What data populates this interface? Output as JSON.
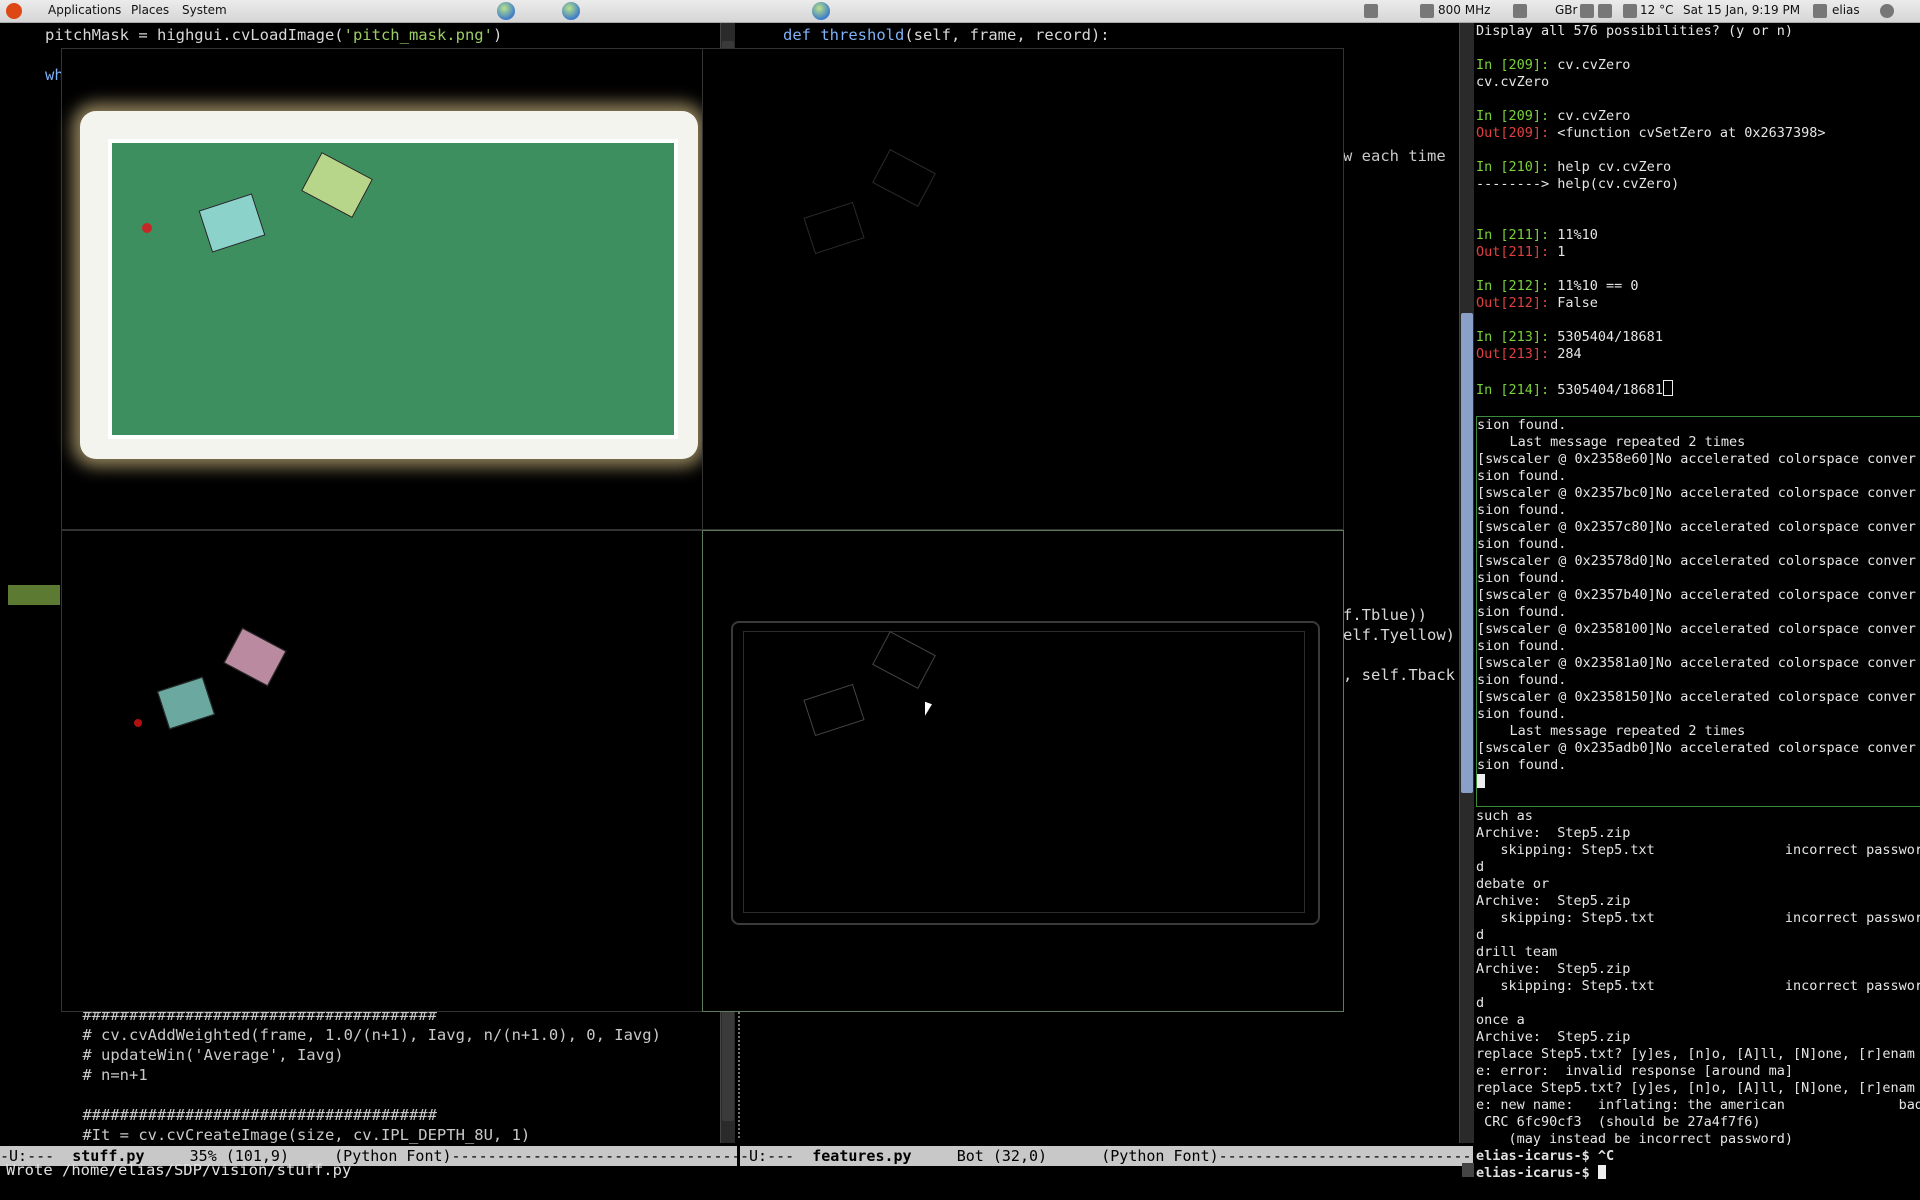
{
  "panel": {
    "menus": [
      "Applications",
      "Places",
      "System"
    ],
    "cpu": "800 MHz",
    "keyboard": "GBr",
    "temperature": "12 °C",
    "datetime": "Sat 15 Jan,  9:19 PM",
    "user": "elias"
  },
  "editor_left": {
    "line1": "pitchMask = highgui.cvLoadImage(",
    "line1_str": "'pitch_mask.png'",
    "line1_end": ")",
    "line2": "wh",
    "bottom_lines": [
      "    ######################################",
      "    # cv.cvAddWeighted(frame, 1.0/(n+1), Iavg, n/(n+1.0), 0, Iavg)",
      "    # updateWin('Average', Iavg)",
      "    # n=n+1",
      "",
      "    ######################################",
      "    #It = cv.cvCreateImage(size, cv.IPL_DEPTH_8U, 1)"
    ],
    "modeline": "-U:---  ",
    "filename": "stuff.py",
    "modeline_rest": "     35% (101,9)     (Python Font)--------------------------------------------------------"
  },
  "editor_right": {
    "line1_kw": "def",
    "line1_fn": "threshold",
    "line1_rest": "(self, frame, record):",
    "fragment_each_time": "w each time",
    "fragment_tblue": "f.Tblue))",
    "fragment_tyellow": "elf.Tyellow)",
    "fragment_tback": ", self.Tback",
    "modeline": "-U:---  ",
    "filename": "features.py",
    "modeline_rest": "     Bot (32,0)      (Python Font)------------------------------------------"
  },
  "minibuffer": "Wrote /home/elias/SDP/vision/stuff.py",
  "ipython": [
    {
      "t": "plain",
      "text": "Display all 576 possibilities? (y or n)"
    },
    {
      "t": "blank",
      "text": ""
    },
    {
      "t": "in",
      "num": "209",
      "text": "cv.cvZero"
    },
    {
      "t": "plain",
      "text": "cv.cvZero"
    },
    {
      "t": "blank",
      "text": ""
    },
    {
      "t": "in",
      "num": "209",
      "text": "cv.cvZero"
    },
    {
      "t": "out",
      "num": "209",
      "text": "<function cvSetZero at 0x2637398>"
    },
    {
      "t": "blank",
      "text": ""
    },
    {
      "t": "in",
      "num": "210",
      "text": "help cv.cvZero"
    },
    {
      "t": "plain",
      "text": "--------> help(cv.cvZero)"
    },
    {
      "t": "blank",
      "text": ""
    },
    {
      "t": "blank",
      "text": ""
    },
    {
      "t": "in",
      "num": "211",
      "text": "11%10"
    },
    {
      "t": "out",
      "num": "211",
      "text": "1"
    },
    {
      "t": "blank",
      "text": ""
    },
    {
      "t": "in",
      "num": "212",
      "text": "11%10 == 0"
    },
    {
      "t": "out",
      "num": "212",
      "text": "False"
    },
    {
      "t": "blank",
      "text": ""
    },
    {
      "t": "in",
      "num": "213",
      "text": "5305404/18681"
    },
    {
      "t": "out",
      "num": "213",
      "text": "284"
    },
    {
      "t": "blank",
      "text": ""
    },
    {
      "t": "in",
      "num": "214",
      "text": "5305404/18681"
    }
  ],
  "swscaler": [
    "sion found.",
    "    Last message repeated 2 times",
    "[swscaler @ 0x2358e60]No accelerated colorspace conver",
    "sion found.",
    "[swscaler @ 0x2357bc0]No accelerated colorspace conver",
    "sion found.",
    "[swscaler @ 0x2357c80]No accelerated colorspace conver",
    "sion found.",
    "[swscaler @ 0x23578d0]No accelerated colorspace conver",
    "sion found.",
    "[swscaler @ 0x2357b40]No accelerated colorspace conver",
    "sion found.",
    "[swscaler @ 0x2358100]No accelerated colorspace conver",
    "sion found.",
    "[swscaler @ 0x23581a0]No accelerated colorspace conver",
    "sion found.",
    "[swscaler @ 0x2358150]No accelerated colorspace conver",
    "sion found.",
    "    Last message repeated 2 times",
    "[swscaler @ 0x235adb0]No accelerated colorspace conver",
    "sion found."
  ],
  "shell": [
    "such as",
    "Archive:  Step5.zip",
    "   skipping: Step5.txt                incorrect passwor",
    "d",
    "debate or",
    "Archive:  Step5.zip",
    "   skipping: Step5.txt                incorrect passwor",
    "d",
    "drill team",
    "Archive:  Step5.zip",
    "   skipping: Step5.txt                incorrect passwor",
    "d",
    "once a",
    "Archive:  Step5.zip",
    "replace Step5.txt? [y]es, [n]o, [A]ll, [N]one, [r]enam",
    "e: error:  invalid response [around ma]",
    "replace Step5.txt? [y]es, [n]o, [A]ll, [N]one, [r]enam",
    "e: new name:   inflating: the american              bad",
    " CRC 6fc90cf3  (should be 27a4f7f6)",
    "    (may instead be incorrect password)"
  ],
  "shell_prompt1": "elias-icarus-$ ^C",
  "shell_prompt2": "elias-icarus-$ "
}
